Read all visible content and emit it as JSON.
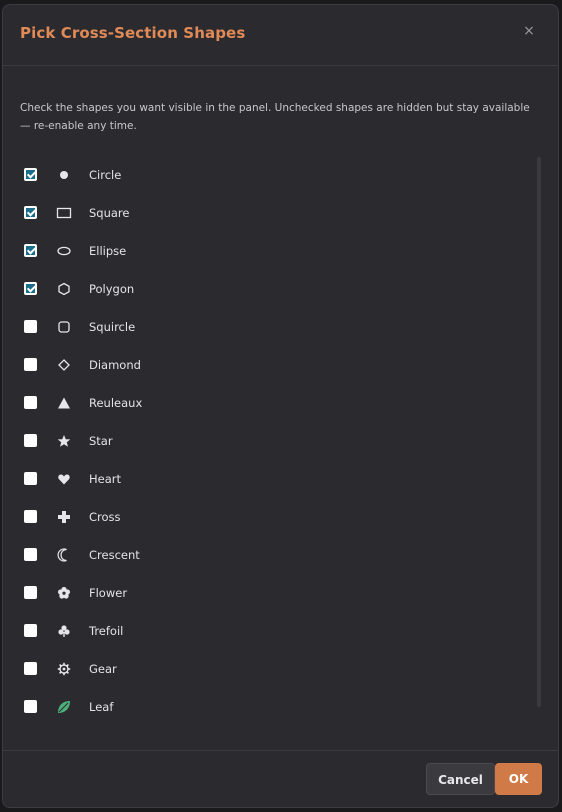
{
  "dialog": {
    "title": "Pick Cross-Section Shapes",
    "close_glyph": "×",
    "description": "Check the shapes you want visible in the panel. Unchecked shapes are hidden but stay available — re-enable any time."
  },
  "shapes": [
    {
      "label": "Circle",
      "checked": true,
      "icon": "circle-icon"
    },
    {
      "label": "Square",
      "checked": true,
      "icon": "square-icon"
    },
    {
      "label": "Ellipse",
      "checked": true,
      "icon": "ellipse-icon"
    },
    {
      "label": "Polygon",
      "checked": true,
      "icon": "hexagon-icon"
    },
    {
      "label": "Squircle",
      "checked": false,
      "icon": "squircle-icon"
    },
    {
      "label": "Diamond",
      "checked": false,
      "icon": "diamond-icon"
    },
    {
      "label": "Reuleaux",
      "checked": false,
      "icon": "triangle-icon"
    },
    {
      "label": "Star",
      "checked": false,
      "icon": "star-icon"
    },
    {
      "label": "Heart",
      "checked": false,
      "icon": "heart-icon"
    },
    {
      "label": "Cross",
      "checked": false,
      "icon": "cross-icon"
    },
    {
      "label": "Crescent",
      "checked": false,
      "icon": "crescent-icon"
    },
    {
      "label": "Flower",
      "checked": false,
      "icon": "flower-icon"
    },
    {
      "label": "Trefoil",
      "checked": false,
      "icon": "trefoil-icon"
    },
    {
      "label": "Gear",
      "checked": false,
      "icon": "gear-icon"
    },
    {
      "label": "Leaf",
      "checked": false,
      "icon": "leaf-icon"
    }
  ],
  "footer": {
    "cancel_label": "Cancel",
    "ok_label": "OK"
  },
  "colors": {
    "accent": "#e08a57",
    "ok_button": "#d07a48",
    "checkbox_checked": "#1a6e8c",
    "leaf_icon": "#4caf7a"
  }
}
